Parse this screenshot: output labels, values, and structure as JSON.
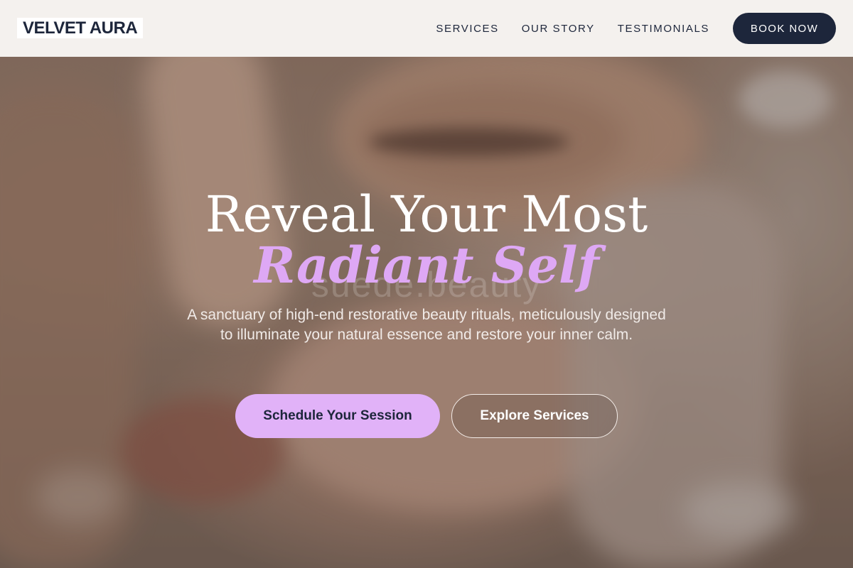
{
  "header": {
    "logo": "VELVET AURA",
    "nav": [
      {
        "label": "SERVICES"
      },
      {
        "label": "OUR STORY"
      },
      {
        "label": "TESTIMONIALS"
      }
    ],
    "cta_label": "BOOK NOW"
  },
  "hero": {
    "headline_line1": "Reveal Your Most",
    "headline_line2": "Radiant Self",
    "subtitle": "A sanctuary of high-end restorative beauty rituals, meticulously designed to illuminate your natural essence and restore your inner calm.",
    "primary_button": "Schedule Your Session",
    "secondary_button": "Explore Services",
    "watermark_text": "suede.beauty",
    "background": "blurred close-up photo of a facial treatment"
  },
  "colors": {
    "navy": "#1d263b",
    "lavender": "#e1b2f8",
    "headline_accent": "#dea8f5",
    "header_bg": "#f4f1ee"
  }
}
